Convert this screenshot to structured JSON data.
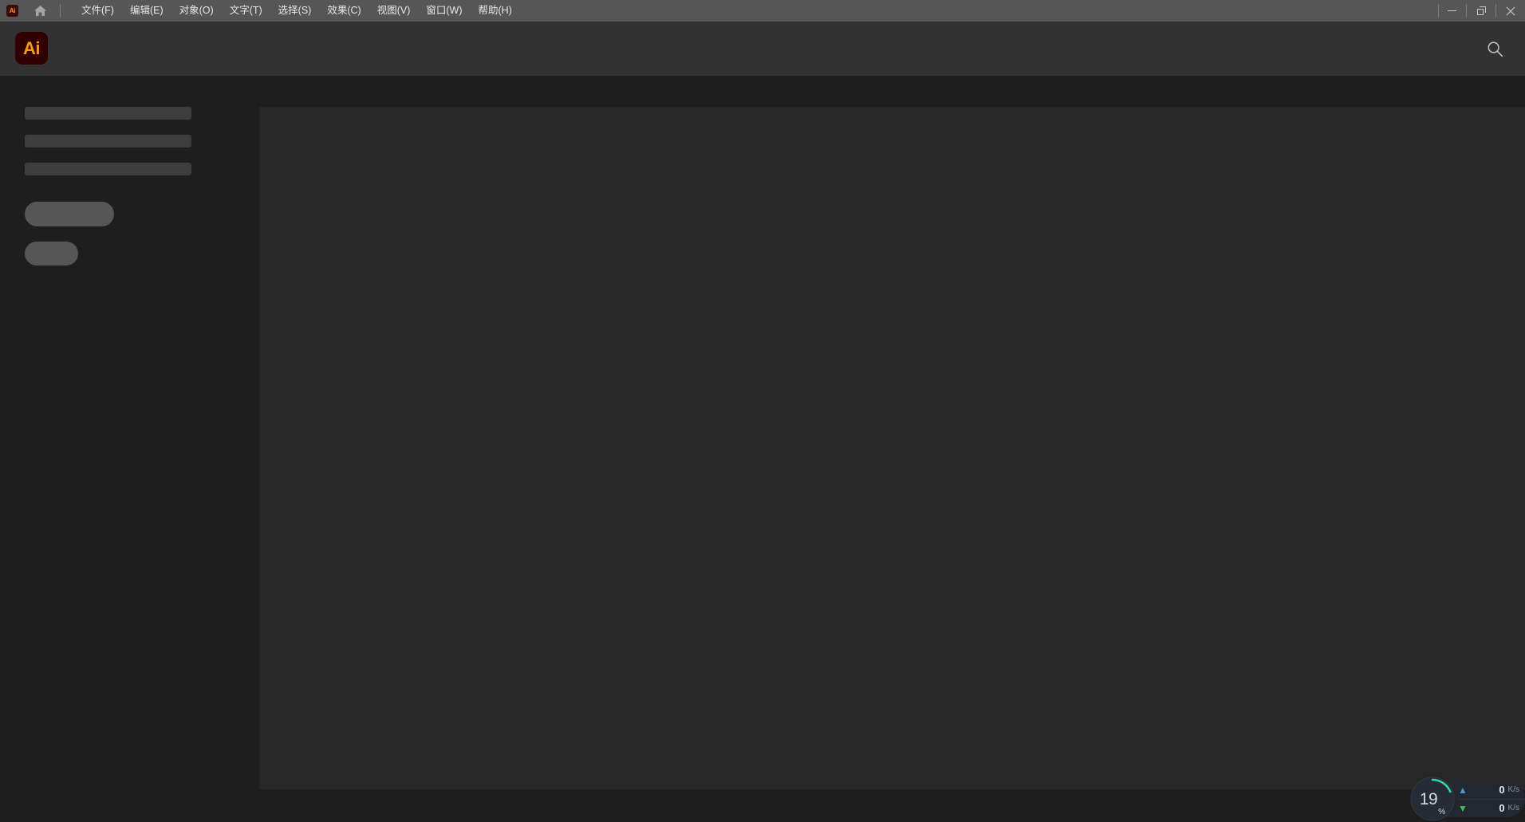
{
  "window": {
    "app_mini_label": "Ai",
    "home_icon": "home-icon",
    "minimize_label": "minimize-icon",
    "maximize_label": "restore-icon",
    "close_label": "close-icon"
  },
  "menubar": {
    "items": [
      {
        "label": "文件(F)"
      },
      {
        "label": "编辑(E)"
      },
      {
        "label": "对象(O)"
      },
      {
        "label": "文字(T)"
      },
      {
        "label": "选择(S)"
      },
      {
        "label": "效果(C)"
      },
      {
        "label": "视图(V)"
      },
      {
        "label": "窗口(W)"
      },
      {
        "label": "帮助(H)"
      }
    ]
  },
  "appbar": {
    "logo_label": "Ai",
    "logo_bg": "#300000",
    "logo_fg": "#ff9a00",
    "search_icon": "search-icon"
  },
  "skeleton": {
    "lines": [
      {},
      {},
      {}
    ],
    "pills": [
      {},
      {}
    ],
    "line_color": "#3d3d3d",
    "pill_color": "#565656"
  },
  "canvas": {
    "background": "#272727"
  },
  "monitor": {
    "cpu_value": "19",
    "cpu_unit": "%",
    "cpu_percent": 19,
    "arc_color": "#2fd6a8",
    "dial_bg": "#262c35",
    "upload": {
      "arrow": "up-arrow-icon",
      "value": "0",
      "unit": "K/s"
    },
    "download": {
      "arrow": "down-arrow-icon",
      "value": "0",
      "unit": "K/s"
    }
  }
}
